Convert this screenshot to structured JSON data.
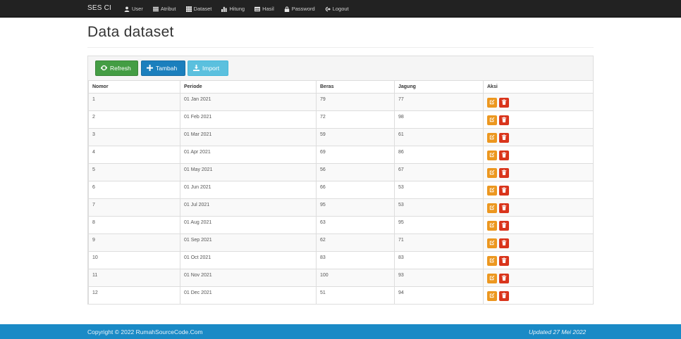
{
  "nav": {
    "brand": "SES CI",
    "items": [
      {
        "label": "User",
        "icon": "user-icon"
      },
      {
        "label": "Atribut",
        "icon": "list-icon"
      },
      {
        "label": "Dataset",
        "icon": "grid-icon"
      },
      {
        "label": "Hitung",
        "icon": "bar-chart-icon"
      },
      {
        "label": "Hasil",
        "icon": "table-icon"
      },
      {
        "label": "Password",
        "icon": "lock-icon"
      },
      {
        "label": "Logout",
        "icon": "logout-icon"
      }
    ]
  },
  "page": {
    "title": "Data dataset"
  },
  "toolbar": {
    "refresh": "Refresh",
    "tambah": "Tambah",
    "import": "Import"
  },
  "table": {
    "headers": [
      "Nomor",
      "Periode",
      "Beras",
      "Jagung",
      "Aksi"
    ],
    "rows": [
      {
        "nomor": "1",
        "periode": "01 Jan 2021",
        "beras": "79",
        "jagung": "77"
      },
      {
        "nomor": "2",
        "periode": "01 Feb 2021",
        "beras": "72",
        "jagung": "98"
      },
      {
        "nomor": "3",
        "periode": "01 Mar 2021",
        "beras": "59",
        "jagung": "61"
      },
      {
        "nomor": "4",
        "periode": "01 Apr 2021",
        "beras": "69",
        "jagung": "86"
      },
      {
        "nomor": "5",
        "periode": "01 May 2021",
        "beras": "56",
        "jagung": "67"
      },
      {
        "nomor": "6",
        "periode": "01 Jun 2021",
        "beras": "66",
        "jagung": "53"
      },
      {
        "nomor": "7",
        "periode": "01 Jul 2021",
        "beras": "95",
        "jagung": "53"
      },
      {
        "nomor": "8",
        "periode": "01 Aug 2021",
        "beras": "63",
        "jagung": "95"
      },
      {
        "nomor": "9",
        "periode": "01 Sep 2021",
        "beras": "62",
        "jagung": "71"
      },
      {
        "nomor": "10",
        "periode": "01 Oct 2021",
        "beras": "83",
        "jagung": "83"
      },
      {
        "nomor": "11",
        "periode": "01 Nov 2021",
        "beras": "100",
        "jagung": "93"
      },
      {
        "nomor": "12",
        "periode": "01 Dec 2021",
        "beras": "51",
        "jagung": "94"
      }
    ]
  },
  "footer": {
    "copyright": "Copyright © 2022 RumahSourceCode.Com",
    "updated": "Updated 27 Mei 2022"
  },
  "colors": {
    "navbar": "#222222",
    "refresh": "#449d44",
    "tambah": "#1b7fbd",
    "import": "#5bc0de",
    "edit": "#ec971f",
    "delete": "#d9351c",
    "footer": "#1a8ac6"
  }
}
